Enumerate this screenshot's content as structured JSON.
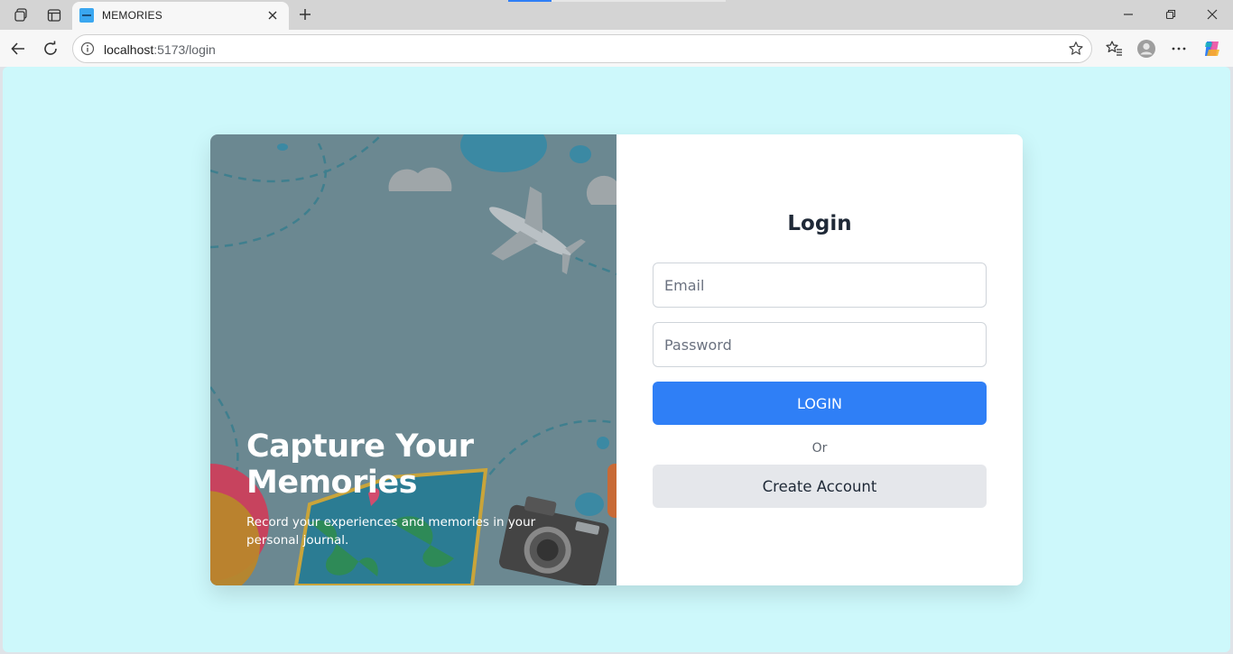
{
  "browser": {
    "tab_title": "MEMORIES",
    "url_host": "localhost",
    "url_path": ":5173/login",
    "accent": "#2f7ff6"
  },
  "hero": {
    "heading": "Capture Your Memories",
    "subtext": "Record your experiences and memories in your personal journal.",
    "background": "#6b8891"
  },
  "login": {
    "title": "Login",
    "email_placeholder": "Email",
    "email_value": "",
    "password_placeholder": "Password",
    "password_value": "",
    "login_button": "LOGIN",
    "or_text": "Or",
    "create_account_button": "Create Account"
  },
  "page": {
    "background": "#cdf8fb"
  },
  "icons": {
    "tab_actions": "workspaces-icon",
    "vertical_tabs": "tab-actions-icon",
    "back": "back-arrow-icon",
    "refresh": "refresh-icon",
    "site_info": "info-icon",
    "favorite": "star-icon",
    "favorites": "favorites-icon",
    "profile": "profile-icon",
    "more": "more-icon",
    "copilot": "copilot-icon"
  }
}
